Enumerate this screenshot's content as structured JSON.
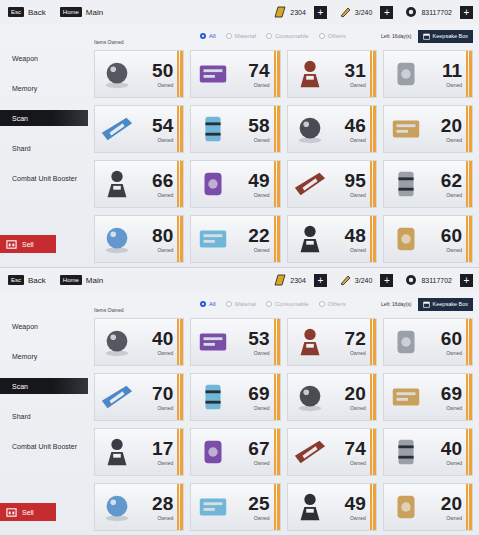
{
  "panels": [
    {
      "topbar": {
        "back": {
          "key": "Esc",
          "label": "Back"
        },
        "main": {
          "key": "Home",
          "label": "Main"
        },
        "currencies": [
          {
            "value": "2304",
            "plus": "+"
          },
          {
            "value": "3/240",
            "plus": "+"
          },
          {
            "value": "83117702",
            "plus": "+"
          }
        ]
      },
      "sidebar": {
        "items": [
          {
            "label": "Weapon",
            "selected": false
          },
          {
            "label": "Memory",
            "selected": false
          },
          {
            "label": "Scan",
            "selected": true
          },
          {
            "label": "Shard",
            "selected": false
          },
          {
            "label": "Combat Unit Booster",
            "selected": false
          }
        ],
        "sell": "Sell"
      },
      "filter": {
        "title": "Items Owned",
        "options": [
          {
            "label": "All",
            "selected": true,
            "disabled": false
          },
          {
            "label": "Material",
            "selected": false,
            "disabled": true
          },
          {
            "label": "Consumable",
            "selected": false,
            "disabled": true
          },
          {
            "label": "Others",
            "selected": false,
            "disabled": true
          }
        ],
        "left": "Left:  16day(s)",
        "keepsake": "Keepsake Box"
      },
      "ownedLabel": "Owned",
      "items": [
        {
          "count": "50"
        },
        {
          "count": "74"
        },
        {
          "count": "31"
        },
        {
          "count": "11"
        },
        {
          "count": "54"
        },
        {
          "count": "58"
        },
        {
          "count": "46"
        },
        {
          "count": "20"
        },
        {
          "count": "66"
        },
        {
          "count": "49"
        },
        {
          "count": "95"
        },
        {
          "count": "62"
        },
        {
          "count": "80"
        },
        {
          "count": "22"
        },
        {
          "count": "48"
        },
        {
          "count": "60"
        }
      ]
    },
    {
      "topbar": {
        "back": {
          "key": "Esc",
          "label": "Back"
        },
        "main": {
          "key": "Home",
          "label": "Main"
        },
        "currencies": [
          {
            "value": "2304",
            "plus": "+"
          },
          {
            "value": "3/240",
            "plus": "+"
          },
          {
            "value": "83117702",
            "plus": "+"
          }
        ]
      },
      "sidebar": {
        "items": [
          {
            "label": "Weapon",
            "selected": false
          },
          {
            "label": "Memory",
            "selected": false
          },
          {
            "label": "Scan",
            "selected": true
          },
          {
            "label": "Shard",
            "selected": false
          },
          {
            "label": "Combat Unit Booster",
            "selected": false
          }
        ],
        "sell": "Sell"
      },
      "filter": {
        "title": "Items Owned",
        "options": [
          {
            "label": "All",
            "selected": true,
            "disabled": false
          },
          {
            "label": "Material",
            "selected": false,
            "disabled": true
          },
          {
            "label": "Consumable",
            "selected": false,
            "disabled": true
          },
          {
            "label": "Others",
            "selected": false,
            "disabled": true
          }
        ],
        "left": "Left:  16day(s)",
        "keepsake": "Keepsake Box"
      },
      "ownedLabel": "Owned",
      "items": [
        {
          "count": "40"
        },
        {
          "count": "53"
        },
        {
          "count": "72"
        },
        {
          "count": "60"
        },
        {
          "count": "70"
        },
        {
          "count": "69"
        },
        {
          "count": "20"
        },
        {
          "count": "69"
        },
        {
          "count": "17"
        },
        {
          "count": "67"
        },
        {
          "count": "74"
        },
        {
          "count": "40"
        },
        {
          "count": "28"
        },
        {
          "count": "25"
        },
        {
          "count": "49"
        },
        {
          "count": "20"
        }
      ]
    }
  ]
}
